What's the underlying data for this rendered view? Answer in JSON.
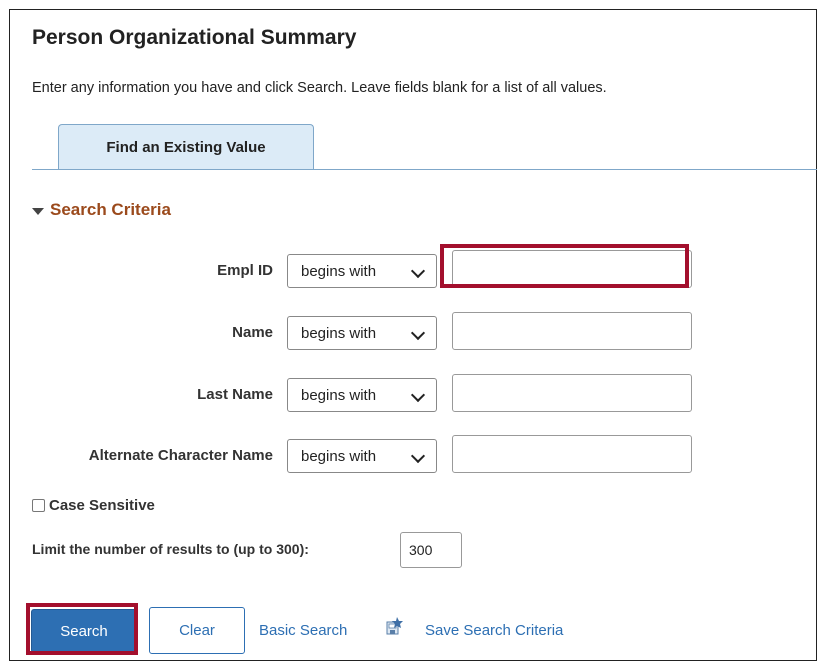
{
  "page": {
    "title": "Person Organizational Summary",
    "instructions": "Enter any information you have and click Search. Leave fields blank for a list of all values."
  },
  "tabs": [
    {
      "label": "Find an Existing Value",
      "active": true
    }
  ],
  "search_criteria": {
    "header": "Search Criteria",
    "fields": [
      {
        "label": "Empl ID",
        "operator": "begins with",
        "value": "",
        "highlighted": true
      },
      {
        "label": "Name",
        "operator": "begins with",
        "value": ""
      },
      {
        "label": "Last Name",
        "operator": "begins with",
        "value": ""
      },
      {
        "label": "Alternate Character Name",
        "operator": "begins with",
        "value": ""
      }
    ],
    "case_sensitive": {
      "label": "Case Sensitive",
      "checked": false
    },
    "limit": {
      "label": "Limit the number of results to (up to 300):",
      "value": "300"
    }
  },
  "actions": {
    "search_label": "Search",
    "clear_label": "Clear",
    "basic_search_label": "Basic Search",
    "save_criteria_label": "Save Search Criteria"
  },
  "colors": {
    "primary_button": "#2d6fb3",
    "link": "#2d6fb3",
    "section_header": "#9b4a1c",
    "tab_background": "#dcebf7",
    "highlight_box": "#a30f2d"
  },
  "icons": {
    "collapse": "triangle-down-icon",
    "dropdown": "chevron-down-icon",
    "save": "save-criteria-icon"
  }
}
